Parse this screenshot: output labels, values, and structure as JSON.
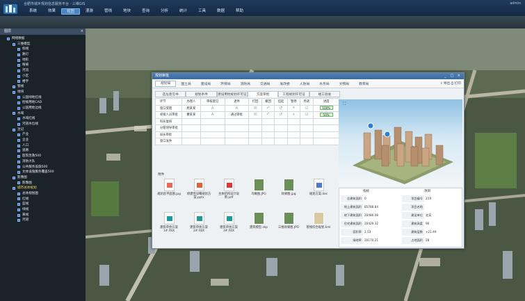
{
  "app": {
    "title": "合肥市城乡规划信息服务平台 · 三维GIS",
    "user": "admin"
  },
  "menu": [
    "系统",
    "效果",
    "视图",
    "漫游",
    "管线",
    "地块",
    "查询",
    "分析",
    "统计",
    "工具",
    "数据",
    "帮助"
  ],
  "menu_active": 2,
  "sidebar": {
    "title": "图层",
    "tree": [
      {
        "label": "网络数据",
        "level": 0
      },
      {
        "label": "三维模型",
        "level": 1
      },
      {
        "label": "标线",
        "level": 2
      },
      {
        "label": "路灯",
        "level": 2
      },
      {
        "label": "地形",
        "level": 2
      },
      {
        "label": "植被",
        "level": 2
      },
      {
        "label": "河流",
        "level": 2
      },
      {
        "label": "小区",
        "level": 2
      },
      {
        "label": "楼宇",
        "level": 2
      },
      {
        "label": "管线",
        "level": 1
      },
      {
        "label": "地块",
        "level": 1
      },
      {
        "label": "公园绿地红线",
        "level": 2
      },
      {
        "label": "控规用地CAD",
        "level": 2
      },
      {
        "label": "公园用地边线",
        "level": 2
      },
      {
        "label": "水域",
        "level": 1
      },
      {
        "label": "水域红线",
        "level": 2
      },
      {
        "label": "河道水位线",
        "level": 2
      },
      {
        "label": "注记",
        "level": 1
      },
      {
        "label": "产业",
        "level": 2
      },
      {
        "label": "企业",
        "level": 2
      },
      {
        "label": "人口",
        "level": 2
      },
      {
        "label": "道路",
        "level": 2
      },
      {
        "label": "医院急救500",
        "level": 2
      },
      {
        "label": "消防大队",
        "level": 2
      },
      {
        "label": "公共服务设施500",
        "level": 2
      },
      {
        "label": "文体设施服务覆盖500",
        "level": 2
      },
      {
        "label": "影像图",
        "level": 1
      },
      {
        "label": "影像图",
        "level": 2
      },
      {
        "label": "城市总体规划",
        "level": 1,
        "selected": true
      },
      {
        "label": "总体规划图",
        "level": 2
      },
      {
        "label": "红线",
        "level": 2
      },
      {
        "label": "蓝线",
        "level": 2
      },
      {
        "label": "绿线",
        "level": 2
      },
      {
        "label": "黄线",
        "level": 2
      },
      {
        "label": "河道",
        "level": 2
      }
    ]
  },
  "dialog": {
    "title": "规划审批",
    "controls": "_ □ ×",
    "tabs": [
      "规划局",
      "国土局",
      "建设局",
      "环保局",
      "消防局",
      "交通局",
      "发改委",
      "人防局",
      "水务局",
      "文物局",
      "教育局"
    ],
    "tab_active": 0,
    "tools": "⇪ 导出  ⎙ 打印",
    "subtabs": [
      "选址意见书",
      "规划条件",
      "建设用地规划许可证",
      "方案审批",
      "工程规划许可证",
      "竣工验收"
    ],
    "subtab_active": 3,
    "grid_header": [
      "环节",
      "办理人",
      "审核意见",
      "退件",
      "打回",
      "撤回",
      "挂起",
      "暂停",
      "传递",
      "进度"
    ],
    "grid_rows": [
      {
        "label": "窗口受理",
        "person": "周某某",
        "progress": "100%"
      },
      {
        "label": "初级人员审批",
        "person": "曹某某",
        "opinion": "通过审批",
        "progress": "50%"
      },
      {
        "label": "科长复核",
        "person": "",
        "progress": ""
      },
      {
        "label": "分管领导审批",
        "person": "",
        "progress": ""
      },
      {
        "label": "局长审批",
        "person": "",
        "progress": ""
      },
      {
        "label": "窗口发件",
        "person": "",
        "progress": ""
      }
    ],
    "attachments_label": "附件",
    "files": [
      {
        "name": "规划总平面图.jpg",
        "type": "img"
      },
      {
        "name": "修建性详细规划方案.pptx",
        "type": "ppt"
      },
      {
        "name": "主体结构设计说明.pdf",
        "type": "pdf"
      },
      {
        "name": "鸟瞰图.JPG",
        "type": "photo"
      },
      {
        "name": "效果图.jpg",
        "type": "photo"
      },
      {
        "name": "规划方案.doc",
        "type": "doc"
      },
      {
        "name": "建筑单体方案1#.FBX",
        "type": "fbx"
      },
      {
        "name": "建筑单体方案2#.FBX",
        "type": "fbx"
      },
      {
        "name": "建筑单体方案3#.FBX",
        "type": "fbx"
      },
      {
        "name": "建筑模型.skp",
        "type": "photo"
      },
      {
        "name": "三维效果图.JPG",
        "type": "photo"
      },
      {
        "name": "管线综合规划.kml",
        "type": "map"
      }
    ],
    "info_headers": [
      "指标",
      "项目"
    ],
    "info_left": [
      {
        "k": "总建筑面积",
        "v": "0"
      },
      {
        "k": "地上建筑面积",
        "v": "85788.84"
      },
      {
        "k": "地下建筑面积",
        "v": "20486.08"
      },
      {
        "k": "住宅建筑面积",
        "v": "20429.32"
      },
      {
        "k": "容积率",
        "v": "2.53"
      },
      {
        "k": "绿地率",
        "v": "20170.21"
      }
    ],
    "info_right": [
      {
        "k": "项目编号",
        "v": "219"
      },
      {
        "k": "项目名称",
        "v": ""
      },
      {
        "k": "建设单位",
        "v": "北苑"
      },
      {
        "k": "建筑高度",
        "v": "90"
      },
      {
        "k": "建筑层数",
        "v": "+21.49"
      },
      {
        "k": "占地面积",
        "v": "28"
      }
    ]
  }
}
